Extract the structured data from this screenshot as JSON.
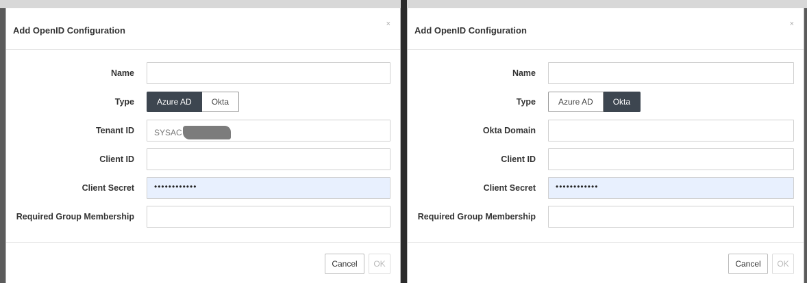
{
  "dialogs": [
    {
      "title": "Add OpenID Configuration",
      "close_label": "×",
      "type_options": [
        "Azure AD",
        "Okta"
      ],
      "selected_type": "Azure AD",
      "fields": [
        {
          "label": "Name",
          "value": ""
        },
        {
          "label": "Tenant ID",
          "value": "SYSAC"
        },
        {
          "label": "Client ID",
          "value": ""
        },
        {
          "label": "Client Secret",
          "value": "••••••••••••"
        },
        {
          "label": "Required Group Membership",
          "value": ""
        }
      ],
      "type_label": "Type",
      "cancel_label": "Cancel",
      "ok_label": "OK"
    },
    {
      "title": "Add OpenID Configuration",
      "close_label": "×",
      "type_options": [
        "Azure AD",
        "Okta"
      ],
      "selected_type": "Okta",
      "fields": [
        {
          "label": "Name",
          "value": ""
        },
        {
          "label": "Okta Domain",
          "value": ""
        },
        {
          "label": "Client ID",
          "value": ""
        },
        {
          "label": "Client Secret",
          "value": "••••••••••••"
        },
        {
          "label": "Required Group Membership",
          "value": ""
        }
      ],
      "type_label": "Type",
      "cancel_label": "Cancel",
      "ok_label": "OK"
    }
  ]
}
